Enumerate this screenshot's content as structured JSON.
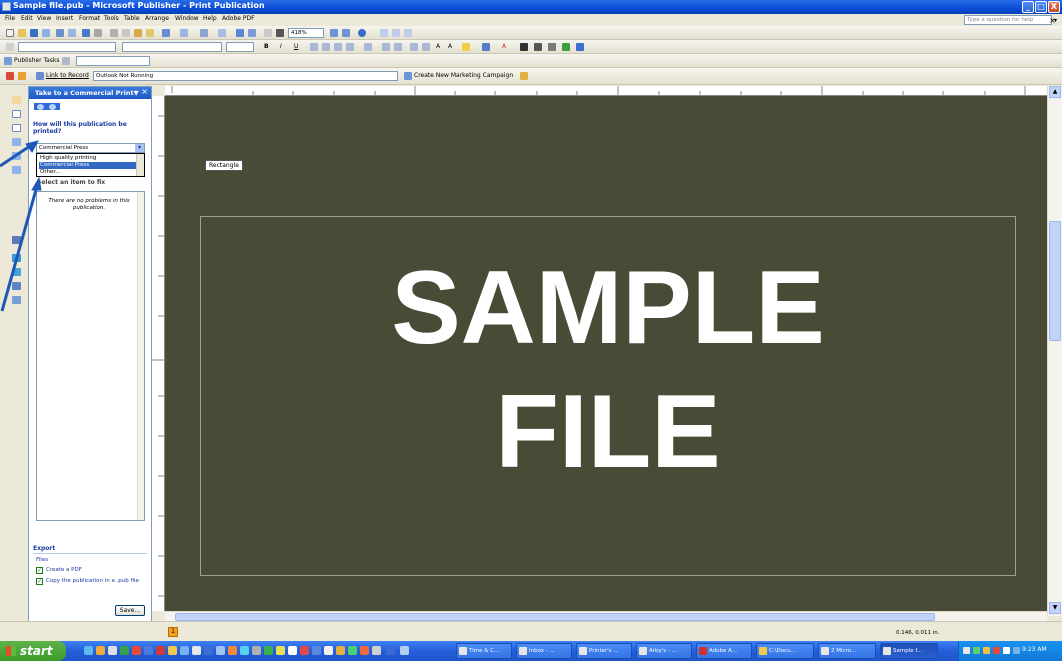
{
  "window": {
    "title": "Sample file.pub - Microsoft Publisher - Print Publication",
    "controls": [
      "_",
      "□",
      "X"
    ]
  },
  "menubar": {
    "items": [
      "File",
      "Edit",
      "View",
      "Insert",
      "Format",
      "Tools",
      "Table",
      "Arrange",
      "Window",
      "Help",
      "Adobe PDF"
    ],
    "ask_placeholder": "Type a question for help"
  },
  "toolbar2": {
    "zoom": "418%"
  },
  "toolbar3": {
    "publisher_tasks": "Publisher Tasks"
  },
  "toolbar4": {
    "link_to_record": "Link to Record",
    "outlook_status": "Outlook Not Running",
    "create_campaign": "Create New Marketing Campaign"
  },
  "taskpane": {
    "title": "Take to a Commercial Print▼",
    "close": "×",
    "question": "How will this publication be printed?",
    "selected_value": "Commercial Press",
    "options": [
      "High quality printing",
      "Commercial Press",
      "Other..."
    ],
    "select_label": "Select an item to fix",
    "problems_text": "There are no problems in this publication.",
    "export_heading": "Export",
    "files_label": "Files",
    "check_pdf": "Create a PDF",
    "check_pub": "Copy the publication in a .pub file",
    "save_button": "Save..."
  },
  "workspace": {
    "tooltip": "Rectangle",
    "line1": "SAMPLE",
    "line2": "FILE",
    "background_color": "#4a4b37"
  },
  "statusbar": {
    "page_number": "1",
    "coordinates": "0.146, 0.011 in."
  },
  "taskbar": {
    "start": "start",
    "tasks": [
      "Time & C...",
      "Inbox - ...",
      "Printer's ...",
      "Arby's - ...",
      "Adobe A...",
      "C:\\Docu...",
      "2 Micro...",
      "Sample f..."
    ],
    "clock": "9:23 AM"
  }
}
